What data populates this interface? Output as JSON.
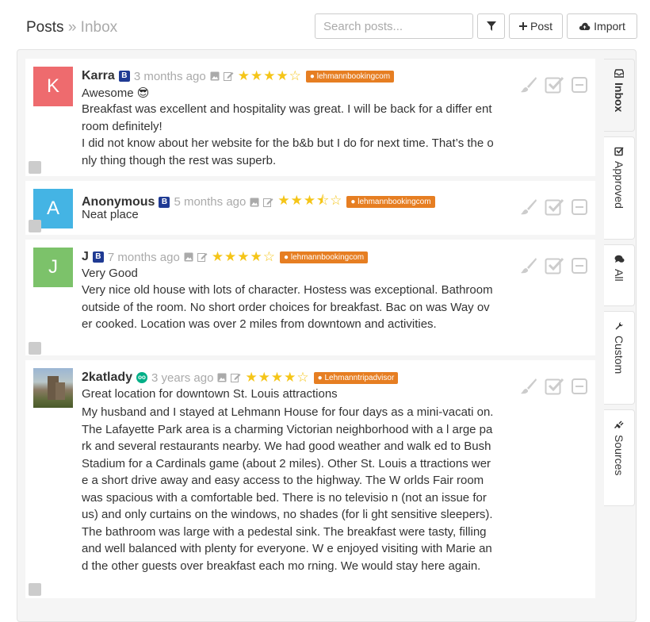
{
  "header": {
    "crumb1": "Posts",
    "sep": "»",
    "crumb2": "Inbox",
    "search_placeholder": "Search posts...",
    "post_btn": "Post",
    "import_btn": "Import"
  },
  "tabs": [
    {
      "label": "Inbox",
      "icon": "inbox-icon"
    },
    {
      "label": "Approved",
      "icon": "check-square-icon"
    },
    {
      "label": "All",
      "icon": "comments-icon"
    },
    {
      "label": "Custom",
      "icon": "wrench-icon"
    },
    {
      "label": "Sources",
      "icon": "plug-icon"
    }
  ],
  "posts": [
    {
      "initial": "K",
      "color": "#ee6b6e",
      "author": "Karra",
      "badge": "B",
      "time": "3 months ago",
      "stars": "★★★★☆",
      "source": "lehmannbookingcom",
      "title": "Awesome 😎",
      "body": "Breakfast was excellent and hospitality was great. I will be back for a differ ent room definitely!\nI did not know about her website for the b&b but I do for next time. That’s the only thing though the rest was superb."
    },
    {
      "initial": "A",
      "color": "#44b4e4",
      "author": "Anonymous",
      "badge": "B",
      "time": "5 months ago",
      "stars": "★★★⯪☆",
      "source": "lehmannbookingcom",
      "title": "Neat place",
      "body": ""
    },
    {
      "initial": "J",
      "color": "#7cc26a",
      "author": "J",
      "badge": "B",
      "time": "7 months ago",
      "stars": "★★★★☆",
      "source": "lehmannbookingcom",
      "title": "Very Good",
      "body": "Very nice old house with lots of character. Hostess was exceptional. Bathroom outside of the room. No short order choices for breakfast. Bac on was Way over cooked. Location was over 2 miles from downtown and activities."
    },
    {
      "initial": "",
      "color": "",
      "author": "2katlady",
      "badge": "oo",
      "time": "3 years ago",
      "stars": "★★★★☆",
      "source": "Lehmanntripadvisor",
      "title": "Great location for downtown St. Louis attractions",
      "body": "My husband and I stayed at Lehmann House for four days as a mini-vacati on. The Lafayette Park area is a charming Victorian neighborhood with a l arge park and several restaurants nearby. We had good weather and walk ed to Bush Stadium for a Cardinals game (about 2 miles). Other St. Louis a ttractions were a short drive away and easy access to the highway. The W orlds Fair room was spacious with a comfortable bed. There is no televisio n (not an issue for us) and only curtains on the windows, no shades (for li ght sensitive sleepers). The bathroom was large with a pedestal sink. The breakfast were tasty, filling and well balanced with plenty for everyone. W e enjoyed visiting with Marie and the other guests over breakfast each mo rning. We would stay here again."
    }
  ]
}
